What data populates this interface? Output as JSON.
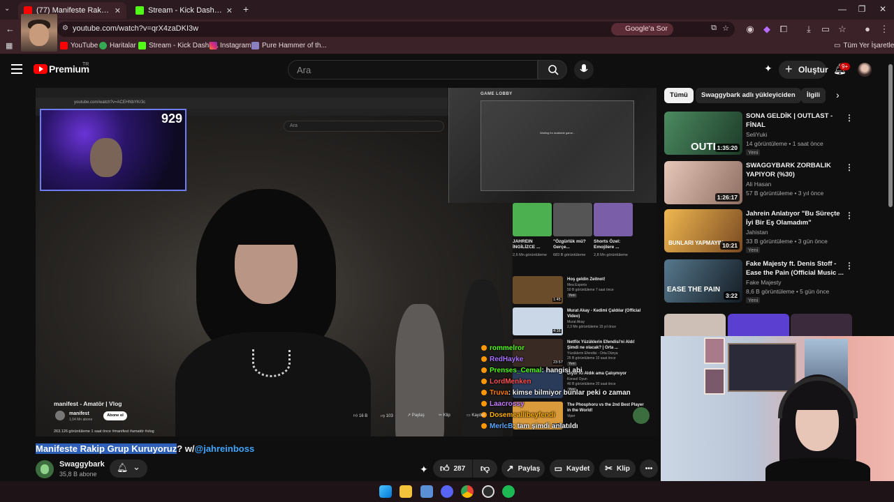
{
  "browser": {
    "tabs": [
      {
        "title": "(77) Manifeste Rakip Grup Kuru",
        "active": true
      },
      {
        "title": "Stream - Kick Dashboard",
        "active": false
      }
    ],
    "new_tab": "+",
    "url": "youtube.com/watch?v=qrX4zaDKI3w",
    "ask_google": "Google'a Sor",
    "bookmarks": [
      "YouTube",
      "Haritalar",
      "Stream - Kick Dashb...",
      "Instagram",
      "Pure Hammer of th..."
    ],
    "all_bookmarks": "Tüm Yer İşaretleri"
  },
  "youtube": {
    "logo": "Premium",
    "region": "TR",
    "search_placeholder": "Ara",
    "create_label": "Oluştur",
    "notif_count": "9+"
  },
  "player": {
    "viewer_count": "929",
    "lobby_title": "GAME LOBBY",
    "lobby_message": "Waiting for available game...",
    "inner_search": "Ara",
    "inner_url": "youtube.com/watch?v=ACEHNbYKr3c",
    "inner_video_title": "manifest - Amatör | Vlog",
    "inner_channel": "manifest",
    "inner_subs": "1,04 Mn abone",
    "inner_subscribe": "Abone ol",
    "inner_likes": "16 B",
    "inner_comments": "103",
    "inner_share": "Paylaş",
    "inner_clip": "Klip",
    "inner_save": "Kaydet",
    "inner_views": "263.126 görüntüleme  1 saat önce  #manifest #amatör #vlog",
    "shorts": [
      {
        "title": "JAHREIN İNGİLİZCE ...",
        "views": "2,6 Mn görüntüleme",
        "color": "#4caf50"
      },
      {
        "title": "\"Özgürlük mü? Gerçe...",
        "views": "683 B görüntüleme",
        "color": "#555555"
      },
      {
        "title": "Shorts Özel: Emojilere ...",
        "views": "2,8 Mn görüntüleme",
        "color": "#7a5fa8"
      }
    ],
    "mini_recs": [
      {
        "title": "Hoş geldin Zeitnot!",
        "sub1": "Mea Esports",
        "sub2": "50 B görüntüleme  7 saat önce",
        "badge": "Yeni",
        "dur": "1:45",
        "color": "#6b4c2a"
      },
      {
        "title": "Murat Akay - Kedimi Çaldılar (Official Video)",
        "sub1": "Murat Akay",
        "sub2": "2,3 Mn görüntüleme  15 yıl önce",
        "badge": "",
        "dur": "4:16",
        "color": "#c9d7e6"
      },
      {
        "title": "Netflix Yüzüklerin Efendisi'ni Aldı! Şimdi ne olacak? | Orta ...",
        "sub1": "Yüzüklerin Efendisi - Orta Dünya",
        "sub2": "25 B görüntüleme  10 saat önce",
        "badge": "Yeni",
        "dur": "23:57",
        "color": "#3a2a24"
      },
      {
        "title": "Diyor Ki Aldık ama Çalışmıyor",
        "sub1": "Konsol Oyun",
        "sub2": "40 B görüntüleme  20 saat önce",
        "badge": "Yeni",
        "dur": "",
        "color": "#2a3b5a"
      },
      {
        "title": "The Phosphoru vs the 2nd Best Player in the World!",
        "sub1": "Viper",
        "sub2": "",
        "badge": "",
        "dur": "15:13",
        "color": "#d89a3a"
      }
    ],
    "chat": [
      {
        "user": "rommelror",
        "msg": "",
        "color": "#53fc18"
      },
      {
        "user": "RedHayke",
        "msg": "",
        "color": "#a970ff"
      },
      {
        "user": "Prenses_Cemal",
        "msg": ": hangisi abi",
        "color": "#53fc18"
      },
      {
        "user": "LordMenken",
        "msg": "",
        "color": "#ff4f4f"
      },
      {
        "user": "Truva",
        "msg": ": kimse bilmiyor bunlar peki o zaman",
        "color": "#ff7a00"
      },
      {
        "user": "Laacrossy",
        "msg": "",
        "color": "#c77dff"
      },
      {
        "user": "Dosemeallibeyfendi",
        "msg": "",
        "color": "#ffb000"
      },
      {
        "user": "MerlcB",
        "msg": ": tam şimdi anlatıldı",
        "color": "#5aa7ff"
      }
    ]
  },
  "video": {
    "title_highlight": "Manifeste Rakip Grup Kuruyoruz",
    "title_rest": "? w/",
    "title_mention": "@jahreinboss",
    "channel": "Swaggybark",
    "subscribers": "35,8 B abone",
    "likes": "287",
    "share": "Paylaş",
    "save": "Kaydet",
    "clip": "Klip"
  },
  "sidebar": {
    "chips": [
      "Tümü",
      "Swaggybark adlı yükleyiciden",
      "İlgili"
    ],
    "recs": [
      {
        "title": "SONA GELDİK | OUTLAST - FİNAL",
        "channel": "SeliYuki",
        "meta": "14 görüntüleme • 1 saat önce",
        "badge": "Yeni",
        "duration": "1:35:20",
        "thumb": "#2f5a3d",
        "thumb_text": "OUTL"
      },
      {
        "title": "SWAGGYBARK ZORBALIK YAPIYOR (%30)",
        "channel": "Ali Hasan",
        "meta": "57 B görüntüleme • 3 yıl önce",
        "badge": "",
        "duration": "1:26:17",
        "thumb": "#c9a89a",
        "thumb_text": ""
      },
      {
        "title": "Jahrein Anlatıyor \"Bu Süreçte İyi Bir Eş Olamadım\"",
        "channel": "Jahistan",
        "meta": "33 B görüntüleme • 3 gün önce",
        "badge": "Yeni",
        "duration": "10:21",
        "thumb": "#d8a24a",
        "thumb_text": "BUNLARI YAPMAYIN"
      },
      {
        "title": "Fake Majesty ft. Denis Stoff - Ease the Pain (Official Music ...",
        "channel": "Fake Majesty",
        "meta": "8,6 B görüntüleme • 5 gün önce",
        "badge": "Yeni",
        "duration": "3:22",
        "thumb": "#2a3e4a",
        "thumb_text": "EASE THE PAIN"
      }
    ]
  },
  "colors": {
    "accent": "#ff0000",
    "link": "#3ea6ff",
    "highlight": "#2e5fb8"
  }
}
